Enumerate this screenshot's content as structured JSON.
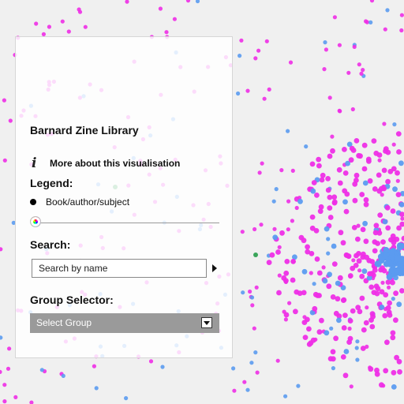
{
  "app": {
    "title": "Barnard Zine Library"
  },
  "info": {
    "label": "More about this visualisation",
    "icon": "info-icon"
  },
  "legend": {
    "heading": "Legend:",
    "item_label": "Book/author/subject"
  },
  "search": {
    "heading": "Search:",
    "placeholder": "Search by name",
    "submit_icon": "play-arrow-icon"
  },
  "group_selector": {
    "heading": "Group Selector:",
    "selected": "Select Group"
  },
  "colors": {
    "magenta": "#ee2ee6",
    "blue": "#5b9bf0",
    "green": "#3aa55a",
    "background": "#f0f0f0"
  }
}
